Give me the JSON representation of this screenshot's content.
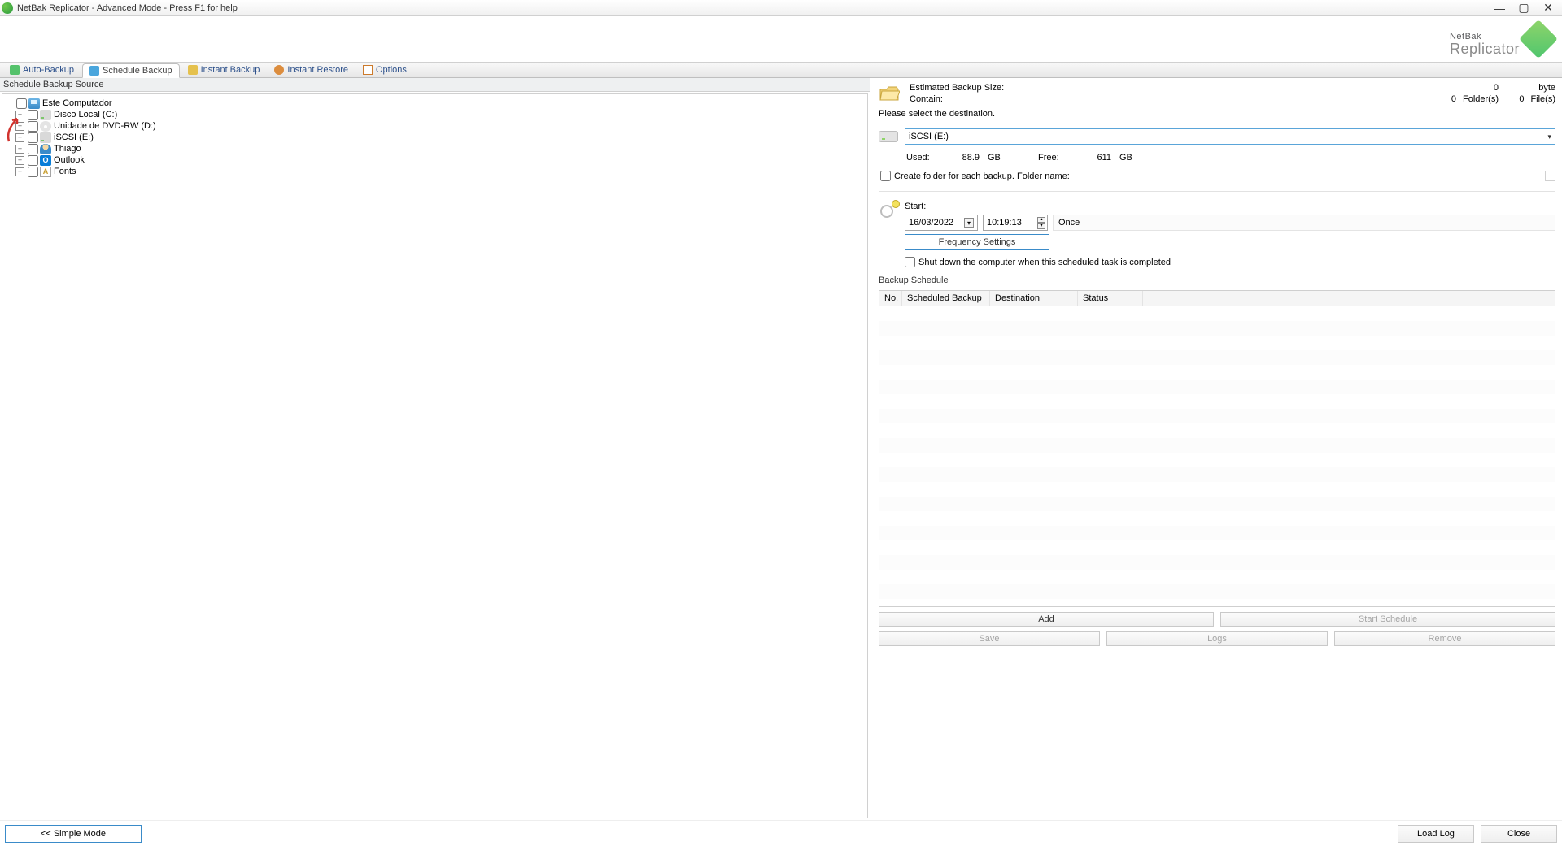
{
  "title": "NetBak Replicator - Advanced Mode - Press F1 for help",
  "logo": {
    "line1": "NetBak",
    "line2": "Replicator"
  },
  "tabs": {
    "auto": "Auto-Backup",
    "schedule": "Schedule Backup",
    "instant_backup": "Instant Backup",
    "instant_restore": "Instant Restore",
    "options": "Options"
  },
  "source": {
    "header": "Schedule Backup Source",
    "root": "Este Computador",
    "children": [
      {
        "label": "Disco Local (C:)",
        "icon": "drive"
      },
      {
        "label": "Unidade de DVD-RW (D:)",
        "icon": "cd"
      },
      {
        "label": "iSCSI (E:)",
        "icon": "drive"
      },
      {
        "label": "Thiago",
        "icon": "user"
      },
      {
        "label": "Outlook",
        "icon": "outlook"
      },
      {
        "label": "Fonts",
        "icon": "fonts"
      }
    ]
  },
  "estimate": {
    "size_label": "Estimated Backup Size:",
    "size_value": "0",
    "size_unit": "byte",
    "contain_label": "Contain:",
    "folders_value": "0",
    "folders_unit": "Folder(s)",
    "files_value": "0",
    "files_unit": "File(s)"
  },
  "destination": {
    "prompt": "Please select the destination.",
    "selected": "iSCSI (E:)",
    "used_label": "Used:",
    "used_value": "88.9",
    "used_unit": "GB",
    "free_label": "Free:",
    "free_value": "611",
    "free_unit": "GB",
    "create_folder_label": "Create folder for each backup. Folder name:",
    "folder_name": ""
  },
  "schedule": {
    "start_label": "Start:",
    "date": "16/03/2022",
    "time": "10:19:13",
    "recurrence": "Once",
    "freq_btn": "Frequency Settings",
    "shutdown_label": "Shut down the computer when this scheduled task is completed",
    "list_label": "Backup Schedule",
    "columns": {
      "no": "No.",
      "scheduled": "Scheduled Backup",
      "destination": "Destination",
      "status": "Status"
    }
  },
  "actions": {
    "add": "Add",
    "start_schedule": "Start Schedule",
    "save": "Save",
    "logs": "Logs",
    "remove": "Remove"
  },
  "footer": {
    "simple_mode": "<<  Simple Mode",
    "load_log": "Load Log",
    "close": "Close"
  }
}
